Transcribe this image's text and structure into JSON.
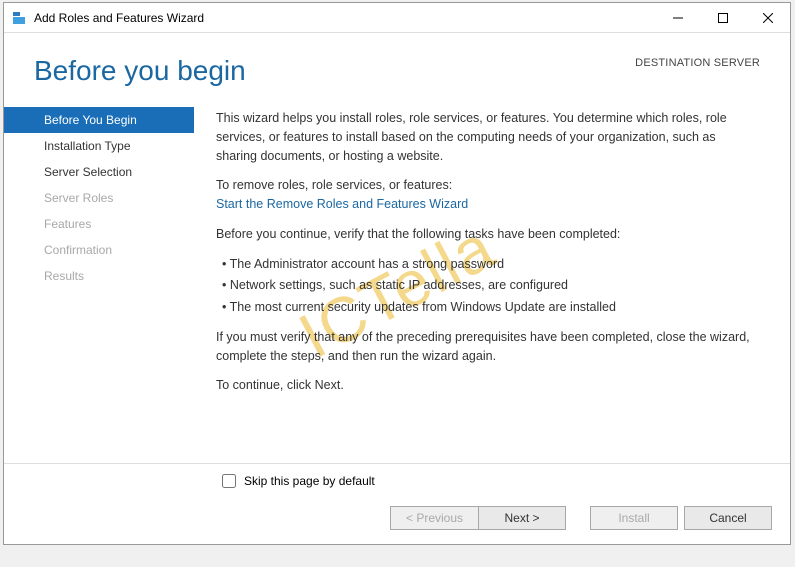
{
  "window": {
    "title": "Add Roles and Features Wizard"
  },
  "header": {
    "page_title": "Before you begin",
    "destination_label": "DESTINATION SERVER",
    "destination_value": ""
  },
  "sidebar": {
    "items": [
      {
        "label": "Before You Begin",
        "state": "selected"
      },
      {
        "label": "Installation Type",
        "state": "enabled"
      },
      {
        "label": "Server Selection",
        "state": "enabled"
      },
      {
        "label": "Server Roles",
        "state": "disabled"
      },
      {
        "label": "Features",
        "state": "disabled"
      },
      {
        "label": "Confirmation",
        "state": "disabled"
      },
      {
        "label": "Results",
        "state": "disabled"
      }
    ]
  },
  "content": {
    "intro": "This wizard helps you install roles, role services, or features. You determine which roles, role services, or features to install based on the computing needs of your organization, such as sharing documents, or hosting a website.",
    "remove_label": "To remove roles, role services, or features:",
    "remove_link": "Start the Remove Roles and Features Wizard",
    "verify_intro": "Before you continue, verify that the following tasks have been completed:",
    "bullets": [
      "The Administrator account has a strong password",
      "Network settings, such as static IP addresses, are configured",
      "The most current security updates from Windows Update are installed"
    ],
    "verify_note": "If you must verify that any of the preceding prerequisites have been completed, close the wizard, complete the steps, and then run the wizard again.",
    "continue_note": "To continue, click Next."
  },
  "footer": {
    "skip_label": "Skip this page by default",
    "buttons": {
      "previous": "< Previous",
      "next": "Next >",
      "install": "Install",
      "cancel": "Cancel"
    }
  },
  "watermark": "ICTella"
}
